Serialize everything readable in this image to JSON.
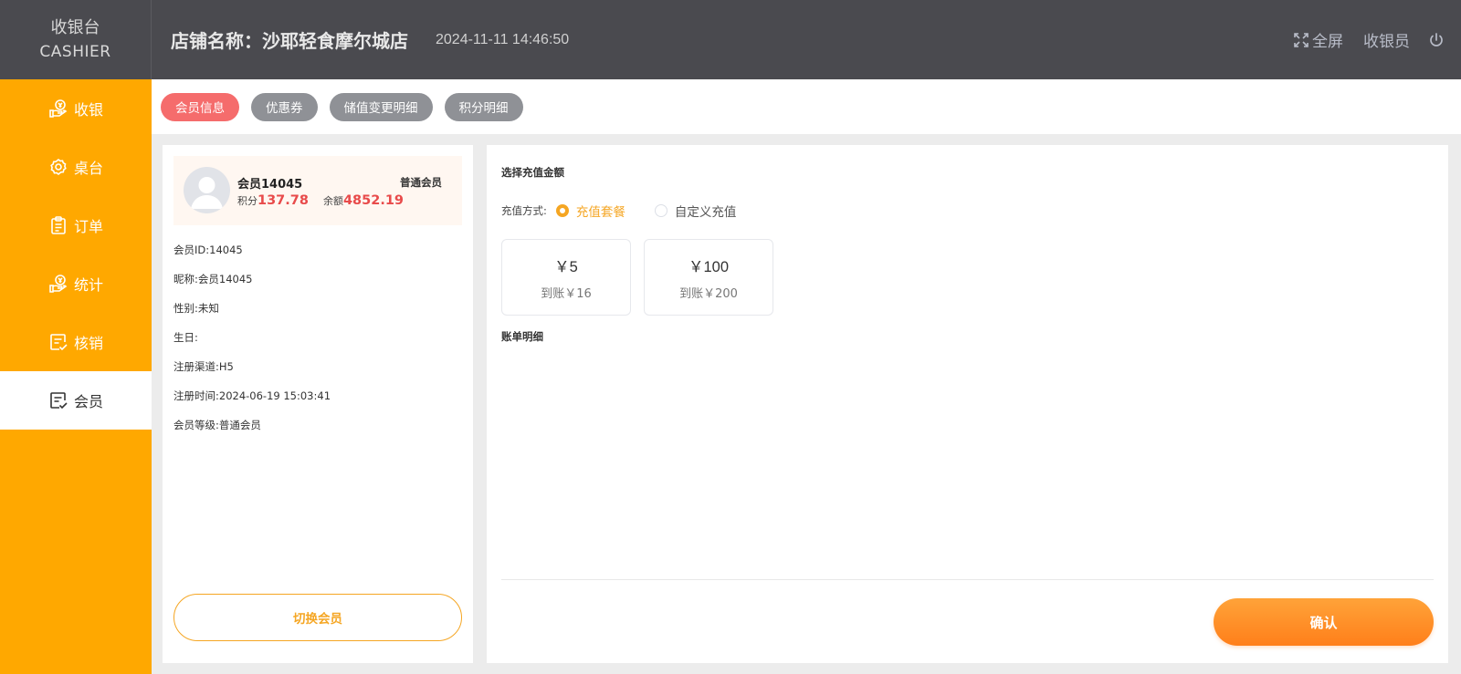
{
  "brand": {
    "line1": "收银台",
    "line2": "CASHIER"
  },
  "header": {
    "store_title": "店铺名称：沙耶轻食摩尔城店",
    "datetime": "2024-11-11 14:46:50",
    "fullscreen_label": "全屏",
    "cashier_label": "收银员"
  },
  "sidebar": {
    "items": [
      {
        "label": "收银",
        "icon": "cashier-hand-icon"
      },
      {
        "label": "桌台",
        "icon": "gear-icon"
      },
      {
        "label": "订单",
        "icon": "clipboard-icon"
      },
      {
        "label": "统计",
        "icon": "stats-hand-icon"
      },
      {
        "label": "核销",
        "icon": "checklist-icon"
      },
      {
        "label": "会员",
        "icon": "member-checklist-icon",
        "active": true
      }
    ]
  },
  "tabs": [
    {
      "label": "会员信息",
      "active": true
    },
    {
      "label": "优惠券"
    },
    {
      "label": "储值变更明细"
    },
    {
      "label": "积分明细"
    }
  ],
  "member": {
    "name": "会员14045",
    "level_badge": "普通会员",
    "points_label": "积分",
    "points_value": "137.78",
    "balance_label": "余额",
    "balance_value": "4852.19",
    "info": [
      "会员ID:14045",
      "昵称:会员14045",
      "性别:未知",
      "生日:",
      "注册渠道:H5",
      "注册时间:2024-06-19 15:03:41",
      "会员等级:普通会员"
    ],
    "switch_label": "切换会员"
  },
  "recharge": {
    "select_title": "选择充值金额",
    "method_label": "充值方式:",
    "option_package": "充值套餐",
    "option_custom": "自定义充值",
    "packages": [
      {
        "price": "￥5",
        "credit": "到账￥16"
      },
      {
        "price": "￥100",
        "credit": "到账￥200"
      }
    ],
    "bill_title": "账单明细",
    "confirm_label": "确认"
  },
  "colors": {
    "header_bg": "#4a4a4f",
    "sidebar_bg": "#ffa800",
    "active_tab": "#f56c6c",
    "inactive_tab": "#8f9196",
    "accent": "#f5a623",
    "amount_red": "#e84b4b"
  }
}
